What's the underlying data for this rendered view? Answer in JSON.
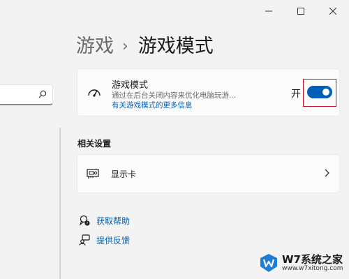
{
  "header": {
    "breadcrumb_parent": "游戏",
    "breadcrumb_separator": "›",
    "page_title": "游戏模式"
  },
  "game_mode": {
    "title": "游戏模式",
    "description": "通过在后台关闭内容来优化电脑玩游...",
    "link": "有关游戏模式的更多信息",
    "toggle_state_label": "开",
    "toggle_on": true,
    "icon": "gauge-icon"
  },
  "related": {
    "section_title": "相关设置",
    "gpu_label": "显示卡",
    "gpu_icon": "graphics-card-icon"
  },
  "links": {
    "get_help": "获取帮助",
    "feedback": "提供反馈"
  },
  "watermark": {
    "name": "W7系统之家",
    "url": "www.w7xitong.com"
  },
  "colors": {
    "accent": "#005fb8",
    "highlight": "#c50f1f",
    "background": "#f3f3f3",
    "card": "#fbfbfb"
  }
}
